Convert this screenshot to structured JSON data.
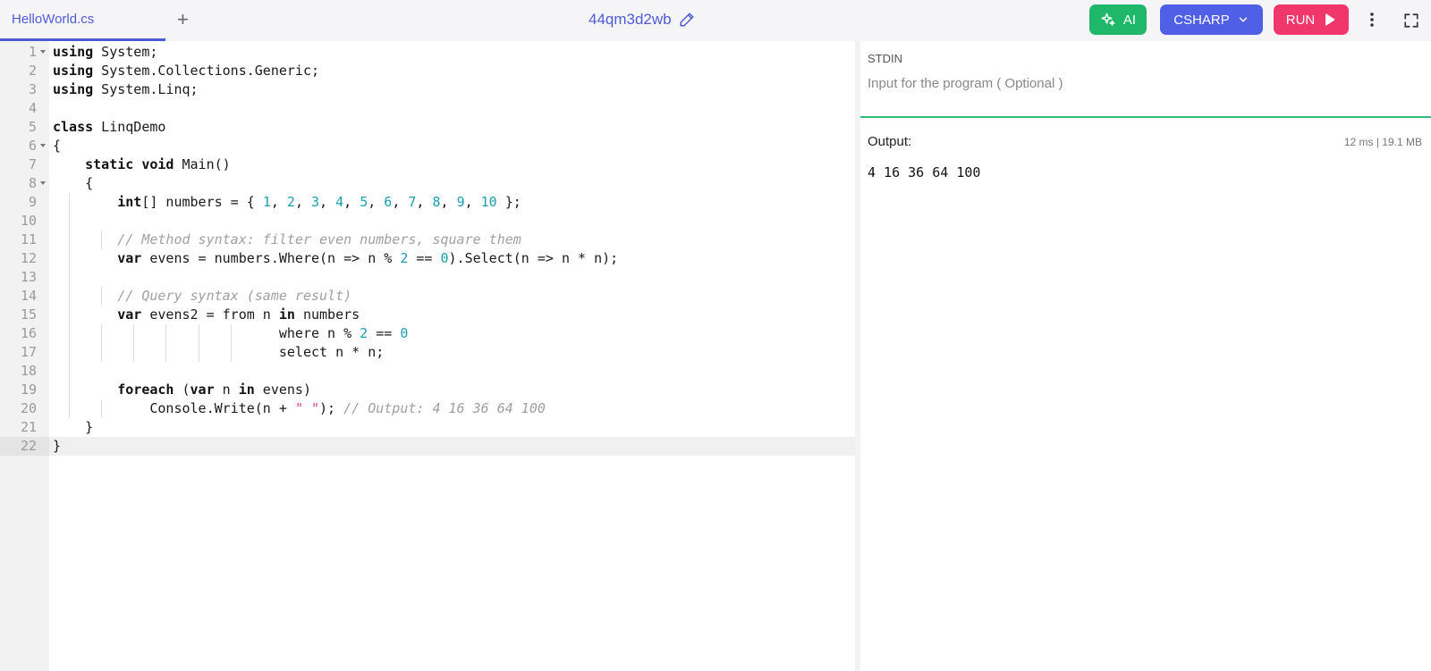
{
  "tabs": {
    "file_name": "HelloWorld.cs",
    "add_label": "+"
  },
  "header": {
    "title": "44qm3d2wb"
  },
  "toolbar": {
    "ai_label": "AI",
    "language_label": "CSHARP",
    "run_label": "RUN"
  },
  "icons": {
    "pencil": "pencil-icon",
    "sparkle": "sparkle-icon",
    "chevron": "chevron-down-icon",
    "play": "play-icon",
    "more": "kebab-menu-icon",
    "fullscreen": "fullscreen-icon"
  },
  "colors": {
    "accent": "#4f5bd5",
    "ai": "#1fb86a",
    "language": "#4f5fe6",
    "run": "#f0366b",
    "stdin_rule": "#2ebd7a"
  },
  "editor": {
    "active_line": 22,
    "lines": [
      {
        "n": "1",
        "fold": true,
        "indent": 0,
        "tokens": [
          [
            "kw",
            "using"
          ],
          [
            "t",
            " System;"
          ]
        ]
      },
      {
        "n": "2",
        "fold": false,
        "indent": 0,
        "tokens": [
          [
            "kw",
            "using"
          ],
          [
            "t",
            " System.Collections.Generic;"
          ]
        ]
      },
      {
        "n": "3",
        "fold": false,
        "indent": 0,
        "tokens": [
          [
            "kw",
            "using"
          ],
          [
            "t",
            " System.Linq;"
          ]
        ]
      },
      {
        "n": "4",
        "fold": false,
        "indent": 0,
        "tokens": []
      },
      {
        "n": "5",
        "fold": false,
        "indent": 0,
        "tokens": [
          [
            "kw",
            "class"
          ],
          [
            "t",
            " LinqDemo"
          ]
        ]
      },
      {
        "n": "6",
        "fold": true,
        "indent": 0,
        "tokens": [
          [
            "t",
            "{"
          ]
        ]
      },
      {
        "n": "7",
        "fold": false,
        "indent": 1,
        "tokens": [
          [
            "t",
            "    "
          ],
          [
            "kw",
            "static void"
          ],
          [
            "t",
            " Main()"
          ]
        ]
      },
      {
        "n": "8",
        "fold": true,
        "indent": 1,
        "tokens": [
          [
            "t",
            "    {"
          ]
        ]
      },
      {
        "n": "9",
        "fold": false,
        "indent": 2,
        "tokens": [
          [
            "t",
            "        "
          ],
          [
            "kw",
            "int"
          ],
          [
            "t",
            "[] numbers = { "
          ],
          [
            "num",
            "1"
          ],
          [
            "t",
            ", "
          ],
          [
            "num",
            "2"
          ],
          [
            "t",
            ", "
          ],
          [
            "num",
            "3"
          ],
          [
            "t",
            ", "
          ],
          [
            "num",
            "4"
          ],
          [
            "t",
            ", "
          ],
          [
            "num",
            "5"
          ],
          [
            "t",
            ", "
          ],
          [
            "num",
            "6"
          ],
          [
            "t",
            ", "
          ],
          [
            "num",
            "7"
          ],
          [
            "t",
            ", "
          ],
          [
            "num",
            "8"
          ],
          [
            "t",
            ", "
          ],
          [
            "num",
            "9"
          ],
          [
            "t",
            ", "
          ],
          [
            "num",
            "10"
          ],
          [
            "t",
            " };"
          ]
        ]
      },
      {
        "n": "10",
        "fold": false,
        "indent": 2,
        "tokens": []
      },
      {
        "n": "11",
        "fold": false,
        "indent": 3,
        "tokens": [
          [
            "t",
            "        "
          ],
          [
            "cm",
            "// Method syntax: filter even numbers, square them"
          ]
        ]
      },
      {
        "n": "12",
        "fold": false,
        "indent": 2,
        "tokens": [
          [
            "t",
            "        "
          ],
          [
            "kw",
            "var"
          ],
          [
            "t",
            " evens = numbers.Where(n => n % "
          ],
          [
            "num",
            "2"
          ],
          [
            "t",
            " == "
          ],
          [
            "num",
            "0"
          ],
          [
            "t",
            ").Select(n => n * n);"
          ]
        ]
      },
      {
        "n": "13",
        "fold": false,
        "indent": 2,
        "tokens": []
      },
      {
        "n": "14",
        "fold": false,
        "indent": 3,
        "tokens": [
          [
            "t",
            "        "
          ],
          [
            "cm",
            "// Query syntax (same result)"
          ]
        ]
      },
      {
        "n": "15",
        "fold": false,
        "indent": 2,
        "tokens": [
          [
            "t",
            "        "
          ],
          [
            "kw",
            "var"
          ],
          [
            "t",
            " evens2 = from n "
          ],
          [
            "kw",
            "in"
          ],
          [
            "t",
            " numbers"
          ]
        ]
      },
      {
        "n": "16",
        "fold": false,
        "indent": 7,
        "tokens": [
          [
            "t",
            "                            where n % "
          ],
          [
            "num",
            "2"
          ],
          [
            "t",
            " == "
          ],
          [
            "num",
            "0"
          ]
        ]
      },
      {
        "n": "17",
        "fold": false,
        "indent": 7,
        "tokens": [
          [
            "t",
            "                            select n * n;"
          ]
        ]
      },
      {
        "n": "18",
        "fold": false,
        "indent": 2,
        "tokens": []
      },
      {
        "n": "19",
        "fold": false,
        "indent": 2,
        "tokens": [
          [
            "t",
            "        "
          ],
          [
            "kw",
            "foreach"
          ],
          [
            "t",
            " ("
          ],
          [
            "kw",
            "var"
          ],
          [
            "t",
            " n "
          ],
          [
            "kw",
            "in"
          ],
          [
            "t",
            " evens)"
          ]
        ]
      },
      {
        "n": "20",
        "fold": false,
        "indent": 3,
        "tokens": [
          [
            "t",
            "            Console.Write(n + "
          ],
          [
            "str",
            "\" \""
          ],
          [
            "t",
            "); "
          ],
          [
            "cm",
            "// Output: 4 16 36 64 100"
          ]
        ]
      },
      {
        "n": "21",
        "fold": false,
        "indent": 1,
        "tokens": [
          [
            "t",
            "    }"
          ]
        ]
      },
      {
        "n": "22",
        "fold": false,
        "indent": 0,
        "tokens": [
          [
            "t",
            "}"
          ]
        ]
      }
    ]
  },
  "stdin": {
    "label": "STDIN",
    "placeholder": "Input for the program ( Optional )"
  },
  "output": {
    "label": "Output:",
    "stats": "12 ms | 19.1 MB",
    "text": "4 16 36 64 100"
  }
}
